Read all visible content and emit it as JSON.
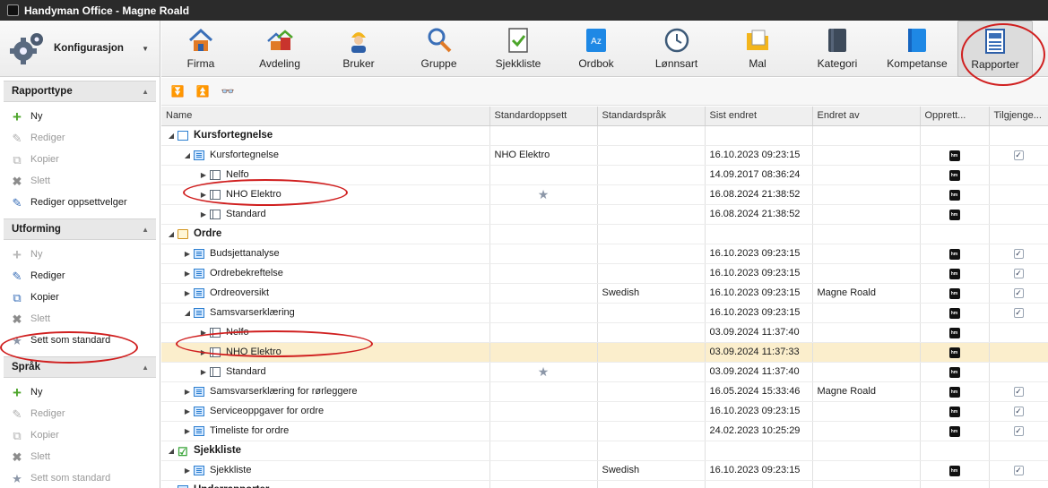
{
  "window_title": "Handyman Office - Magne Roald",
  "config_label": "Konfigurasjon",
  "toolbar": [
    {
      "label": "Firma",
      "icon": "house-icon"
    },
    {
      "label": "Avdeling",
      "icon": "houses-icon"
    },
    {
      "label": "Bruker",
      "icon": "worker-icon"
    },
    {
      "label": "Gruppe",
      "icon": "tools-icon"
    },
    {
      "label": "Sjekkliste",
      "icon": "checklist-icon"
    },
    {
      "label": "Ordbok",
      "icon": "dictionary-icon"
    },
    {
      "label": "Lønnsart",
      "icon": "clock-icon"
    },
    {
      "label": "Mal",
      "icon": "folder-icon"
    },
    {
      "label": "Kategori",
      "icon": "book-icon"
    },
    {
      "label": "Kompetanse",
      "icon": "competence-icon"
    },
    {
      "label": "Rapporter",
      "icon": "report-icon",
      "active": true
    }
  ],
  "sections": [
    {
      "title": "Rapporttype",
      "items": [
        {
          "label": "Ny",
          "icon": "plus-icon",
          "enabled": true
        },
        {
          "label": "Rediger",
          "icon": "edit-icon",
          "enabled": false
        },
        {
          "label": "Kopier",
          "icon": "copy-icon",
          "enabled": false
        },
        {
          "label": "Slett",
          "icon": "delete-icon",
          "enabled": false
        },
        {
          "label": "Rediger oppsettvelger",
          "icon": "edit-icon",
          "enabled": true
        }
      ]
    },
    {
      "title": "Utforming",
      "items": [
        {
          "label": "Ny",
          "icon": "plus-icon",
          "enabled": false
        },
        {
          "label": "Rediger",
          "icon": "edit-icon",
          "enabled": true
        },
        {
          "label": "Kopier",
          "icon": "copy-icon",
          "enabled": true
        },
        {
          "label": "Slett",
          "icon": "delete-icon",
          "enabled": false
        },
        {
          "label": "Sett som standard",
          "icon": "star-icon",
          "enabled": true
        }
      ]
    },
    {
      "title": "Språk",
      "items": [
        {
          "label": "Ny",
          "icon": "plus-icon",
          "enabled": true
        },
        {
          "label": "Rediger",
          "icon": "edit-icon",
          "enabled": false
        },
        {
          "label": "Kopier",
          "icon": "copy-icon",
          "enabled": false
        },
        {
          "label": "Slett",
          "icon": "delete-icon",
          "enabled": false
        },
        {
          "label": "Sett som standard",
          "icon": "star-icon",
          "enabled": false
        }
      ]
    }
  ],
  "columns": [
    "Name",
    "Standardoppsett",
    "Standardspråk",
    "Sist endret",
    "Endret av",
    "Opprett...",
    "Tilgjenge..."
  ],
  "rows": [
    {
      "level": 0,
      "expand": "down",
      "icon": "cat",
      "name": "Kursfortegnelse",
      "bold": true
    },
    {
      "level": 1,
      "expand": "down",
      "icon": "report",
      "name": "Kursfortegnelse",
      "standardoppsett": "NHO Elektro",
      "sist_endret": "16.10.2023 09:23:15",
      "hm": true,
      "check": true
    },
    {
      "level": 2,
      "expand": "right",
      "icon": "layout",
      "name": "Nelfo",
      "sist_endret": "14.09.2017 08:36:24",
      "hm": true
    },
    {
      "level": 2,
      "expand": "right",
      "icon": "layout",
      "name": "NHO Elektro",
      "star": true,
      "sist_endret": "16.08.2024 21:38:52",
      "hm": true
    },
    {
      "level": 2,
      "expand": "right",
      "icon": "layout",
      "name": "Standard",
      "sist_endret": "16.08.2024 21:38:52",
      "hm": true
    },
    {
      "level": 0,
      "expand": "down",
      "icon": "clip",
      "name": "Ordre",
      "bold": true
    },
    {
      "level": 1,
      "expand": "right",
      "icon": "report",
      "name": "Budsjettanalyse",
      "sist_endret": "16.10.2023 09:23:15",
      "hm": true,
      "check": true
    },
    {
      "level": 1,
      "expand": "right",
      "icon": "report",
      "name": "Ordrebekreftelse",
      "sist_endret": "16.10.2023 09:23:15",
      "hm": true,
      "check": true
    },
    {
      "level": 1,
      "expand": "right",
      "icon": "report",
      "name": "Ordreoversikt",
      "standardsprak": "Swedish",
      "sist_endret": "16.10.2023 09:23:15",
      "endret_av": "Magne Roald",
      "hm": true,
      "check": true
    },
    {
      "level": 1,
      "expand": "down",
      "icon": "report",
      "name": "Samsvarserklæring",
      "sist_endret": "16.10.2023 09:23:15",
      "hm": true,
      "check": true
    },
    {
      "level": 2,
      "expand": "right",
      "icon": "layout",
      "name": "Nelfo",
      "sist_endret": "03.09.2024 11:37:40",
      "hm": true
    },
    {
      "level": 2,
      "expand": "right",
      "icon": "layout",
      "name": "NHO Elektro",
      "sist_endret": "03.09.2024 11:37:33",
      "hm": true,
      "highlight": true
    },
    {
      "level": 2,
      "expand": "right",
      "icon": "layout",
      "name": "Standard",
      "star": true,
      "sist_endret": "03.09.2024 11:37:40",
      "hm": true
    },
    {
      "level": 1,
      "expand": "right",
      "icon": "report",
      "name": "Samsvarserklæring for rørleggere",
      "sist_endret": "16.05.2024 15:33:46",
      "endret_av": "Magne Roald",
      "hm": true,
      "check": true
    },
    {
      "level": 1,
      "expand": "right",
      "icon": "report",
      "name": "Serviceoppgaver for ordre",
      "sist_endret": "16.10.2023 09:23:15",
      "hm": true,
      "check": true
    },
    {
      "level": 1,
      "expand": "right",
      "icon": "report",
      "name": "Timeliste for ordre",
      "sist_endret": "24.02.2023 10:25:29",
      "hm": true,
      "check": true
    },
    {
      "level": 0,
      "expand": "down",
      "icon": "checkbox",
      "name": "Sjekkliste",
      "bold": true
    },
    {
      "level": 1,
      "expand": "right",
      "icon": "report",
      "name": "Sjekkliste",
      "standardsprak": "Swedish",
      "sist_endret": "16.10.2023 09:23:15",
      "hm": true,
      "check": true
    },
    {
      "level": 0,
      "expand": "right",
      "icon": "report",
      "name": "Underrapporter",
      "bold": true
    }
  ],
  "colors": {
    "highlight": "#fbeecc",
    "annotation": "#d01f1f",
    "accent": "#2a7fd4"
  }
}
